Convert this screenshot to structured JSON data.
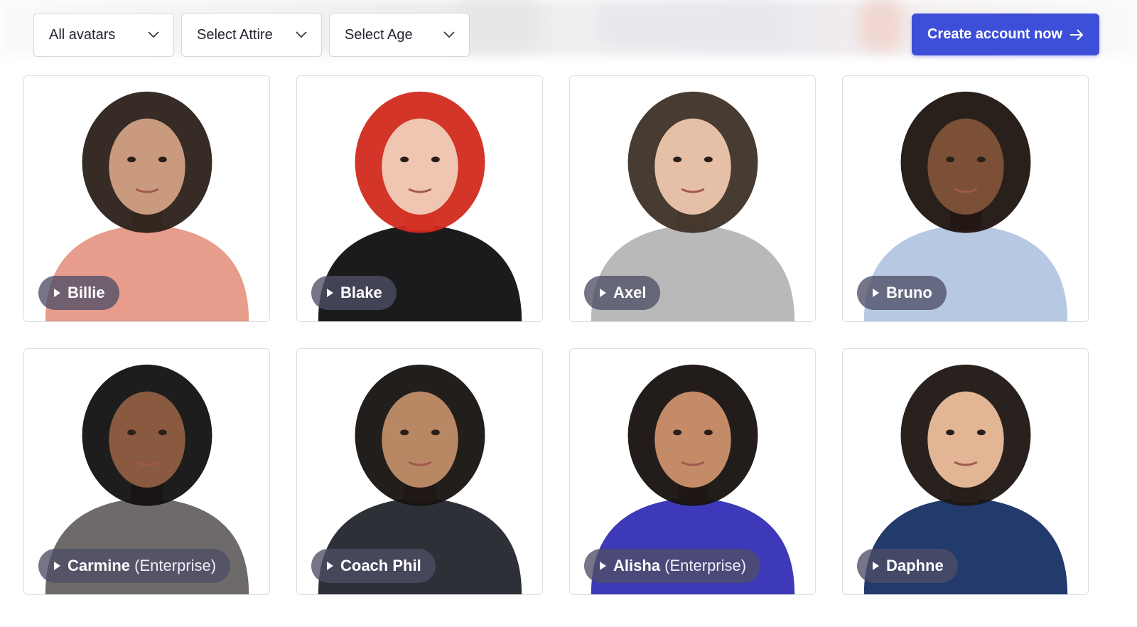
{
  "filters": [
    {
      "label": "All avatars"
    },
    {
      "label": "Select Attire"
    },
    {
      "label": "Select Age"
    }
  ],
  "cta": {
    "label": "Create account now",
    "icon": "arrow-right-icon"
  },
  "avatars": [
    {
      "name": "Billie",
      "tier": "",
      "skin": "#c99a7d",
      "hair": "#2b2019",
      "top": "#e79c8c"
    },
    {
      "name": "Blake",
      "tier": "",
      "skin": "#f0c6b2",
      "hair": "#d22a1e",
      "top": "#1b1b1d"
    },
    {
      "name": "Axel",
      "tier": "",
      "skin": "#e6c0a6",
      "hair": "#3e3027",
      "top": "#b9b9b9"
    },
    {
      "name": "Bruno",
      "tier": "",
      "skin": "#7b5037",
      "hair": "#1d1410",
      "top": "#b7c9e2"
    },
    {
      "name": "Carmine",
      "tier": "(Enterprise)",
      "skin": "#8a5a40",
      "hair": "#111111",
      "top": "#6e6a6a"
    },
    {
      "name": "Coach Phil",
      "tier": "",
      "skin": "#b88764",
      "hair": "#161210",
      "top": "#2d3036"
    },
    {
      "name": "Alisha",
      "tier": "(Enterprise)",
      "skin": "#c38b67",
      "hair": "#16110f",
      "top": "#3d39b8"
    },
    {
      "name": "Daphne",
      "tier": "",
      "skin": "#e2b595",
      "hair": "#1c1512",
      "top": "#223a6c"
    }
  ]
}
